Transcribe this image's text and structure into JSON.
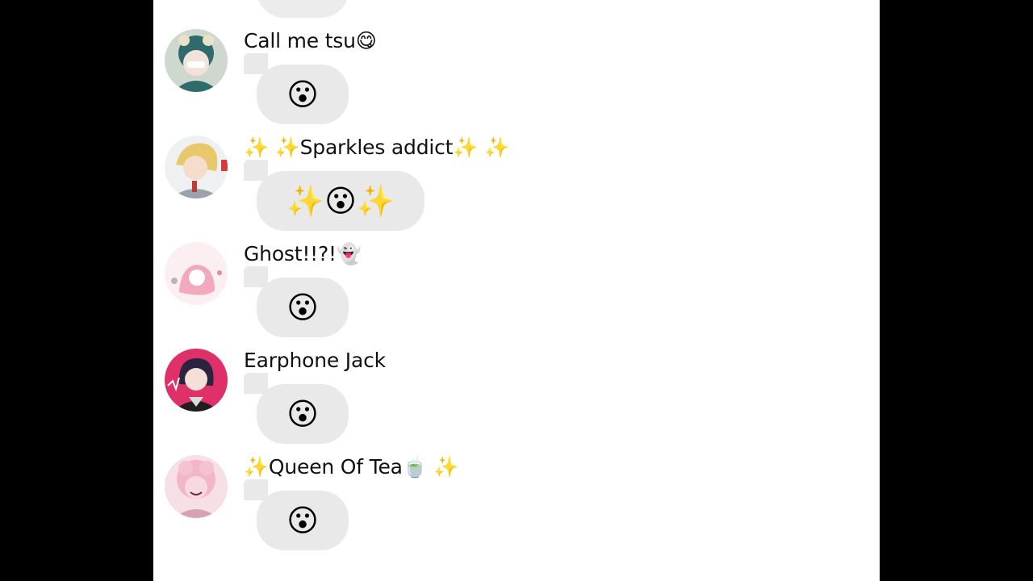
{
  "messages": [
    {
      "name": "Call me tsu😋",
      "reaction": "😮",
      "avatar_colors": [
        "#2f6b6a",
        "#cfd8cf"
      ]
    },
    {
      "name": "✨ ✨Sparkles addict✨ ✨",
      "reaction": "✨😮✨",
      "avatar_colors": [
        "#e8c86a",
        "#bcc3c9"
      ]
    },
    {
      "name": "Ghost!!?!👻",
      "reaction": "😮",
      "avatar_colors": [
        "#f3c2cf",
        "#fbeff2"
      ]
    },
    {
      "name": "Earphone Jack",
      "reaction": "😮",
      "avatar_colors": [
        "#e0306a",
        "#2b2340"
      ]
    },
    {
      "name": "✨Queen Of Tea🍵 ✨",
      "reaction": "😮",
      "avatar_colors": [
        "#f3b6c6",
        "#f7dfe6"
      ]
    }
  ]
}
